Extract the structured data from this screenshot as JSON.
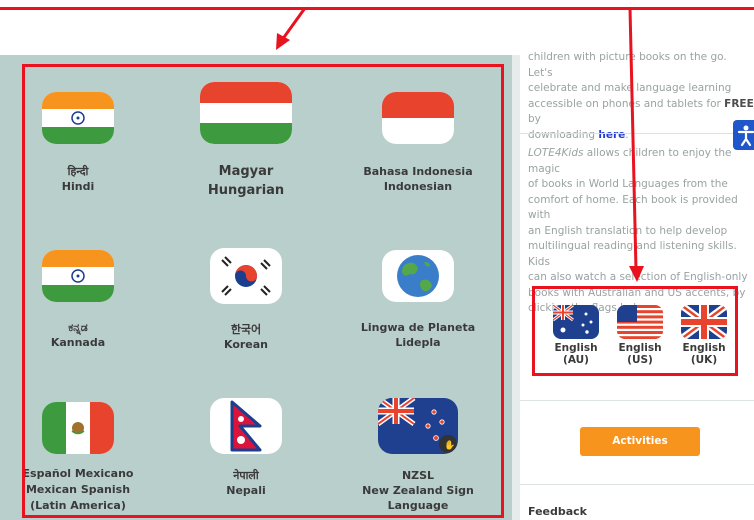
{
  "flags": [
    {
      "name": "flag-hindi",
      "native": "हिन्दी",
      "english": "Hindi"
    },
    {
      "name": "flag-hungarian",
      "native": "Magyar",
      "english": "Hungarian"
    },
    {
      "name": "flag-indonesian",
      "native": "Bahasa Indonesia",
      "english": "Indonesian"
    },
    {
      "name": "flag-kannada",
      "native": "ಕನ್ನಡ",
      "english": "Kannada"
    },
    {
      "name": "flag-korean",
      "native": "한국어",
      "english": "Korean"
    },
    {
      "name": "flag-lidepla",
      "native": "Lingwa de Planeta",
      "english": "Lidepla"
    },
    {
      "name": "flag-mexican-spanish",
      "native": "Español Mexicano",
      "english": "Mexican Spanish",
      "extra": "(Latin America)"
    },
    {
      "name": "flag-nepali",
      "native": "नेपाली",
      "english": "Nepali"
    },
    {
      "name": "flag-nzsl",
      "native": "NZSL",
      "english": "New Zealand Sign Language"
    }
  ],
  "sidebar": {
    "intro_line1": "children with picture books on the go. Let's",
    "intro_line2": "celebrate and make language learning",
    "intro_line3_pre": "accessible on phones and tablets for ",
    "intro_line3_bold": "FREE",
    "intro_line3_post": " by",
    "intro_line4_pre": "downloading ",
    "here_link": "here",
    "intro_line4_post": ".",
    "about_italic": "LOTE4Kids",
    "about_lines": [
      " allows children to enjoy the magic",
      "of books in World Languages from the",
      "comfort of home. Each book is provided with",
      "an English translation to help develop",
      "multilingual reading and listening skills. Kids",
      "can also watch a selection of English-only",
      "books with Australian and US accents, by",
      "clicking the flags below."
    ],
    "english_flags": [
      {
        "label1": "English",
        "label2": "(AU)"
      },
      {
        "label1": "English",
        "label2": "(US)"
      },
      {
        "label1": "English",
        "label2": "(UK)"
      }
    ],
    "activities_label": "Activities",
    "feedback_label": "Feedback"
  },
  "colors": {
    "annotation_red": "#e8131f",
    "panel_bg": "#b9cfcc",
    "activities_orange": "#f7941e",
    "accessibility_blue": "#1f56c9",
    "link_blue": "#1f3bd6"
  },
  "icons": {
    "accessibility": "accessibility-icon",
    "sign_language": "sign-language-icon"
  }
}
